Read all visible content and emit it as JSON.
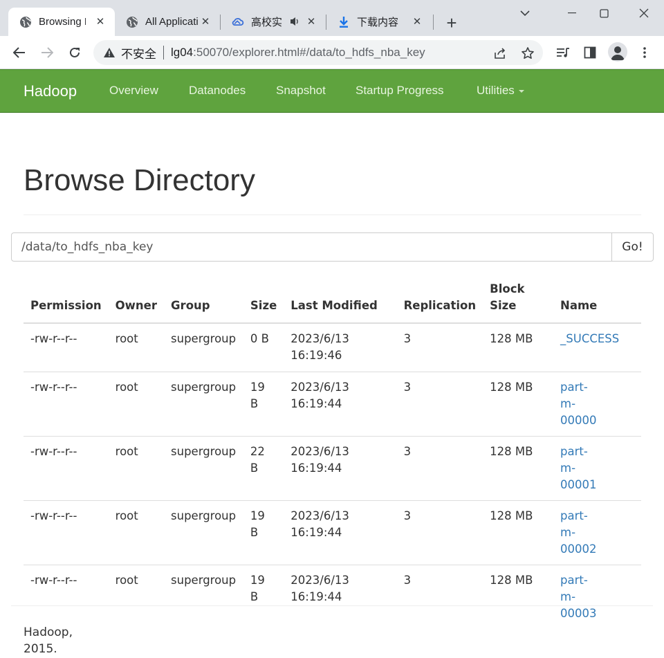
{
  "browser": {
    "tabs": [
      {
        "title": "Browsing HDFS",
        "icon": "globe-icon",
        "active": true
      },
      {
        "title": "All Applications",
        "icon": "globe-icon",
        "active": false
      },
      {
        "title": "高校实",
        "icon": "cloud-icon",
        "active": false,
        "audio": true
      },
      {
        "title": "下载内容",
        "icon": "download-icon",
        "active": false
      }
    ],
    "new_tab_label": "+",
    "security_label": "不安全",
    "url_host": "lg04",
    "url_rest": ":50070/explorer.html#/data/to_hdfs_nba_key"
  },
  "navbar": {
    "brand": "Hadoop",
    "links": [
      "Overview",
      "Datanodes",
      "Snapshot",
      "Startup Progress",
      "Utilities"
    ],
    "color": "#5fa33e"
  },
  "page": {
    "title": "Browse Directory",
    "path_value": "/data/to_hdfs_nba_key",
    "go_label": "Go!"
  },
  "table": {
    "headers": [
      "Permission",
      "Owner",
      "Group",
      "Size",
      "Last Modified",
      "Replication",
      "Block Size",
      "Name"
    ],
    "rows": [
      {
        "permission": "-rw-r--r--",
        "owner": "root",
        "group": "supergroup",
        "size": "0 B",
        "modified": "2023/6/13 16:19:46",
        "replication": "3",
        "block_size": "128 MB",
        "name": "_SUCCESS"
      },
      {
        "permission": "-rw-r--r--",
        "owner": "root",
        "group": "supergroup",
        "size": "19 B",
        "modified": "2023/6/13 16:19:44",
        "replication": "3",
        "block_size": "128 MB",
        "name": "part-m-00000"
      },
      {
        "permission": "-rw-r--r--",
        "owner": "root",
        "group": "supergroup",
        "size": "22 B",
        "modified": "2023/6/13 16:19:44",
        "replication": "3",
        "block_size": "128 MB",
        "name": "part-m-00001"
      },
      {
        "permission": "-rw-r--r--",
        "owner": "root",
        "group": "supergroup",
        "size": "19 B",
        "modified": "2023/6/13 16:19:44",
        "replication": "3",
        "block_size": "128 MB",
        "name": "part-m-00002"
      },
      {
        "permission": "-rw-r--r--",
        "owner": "root",
        "group": "supergroup",
        "size": "19 B",
        "modified": "2023/6/13 16:19:44",
        "replication": "3",
        "block_size": "128 MB",
        "name": "part-m-00003"
      }
    ]
  },
  "footer": {
    "line1": "Hadoop,",
    "line2": "2015."
  }
}
